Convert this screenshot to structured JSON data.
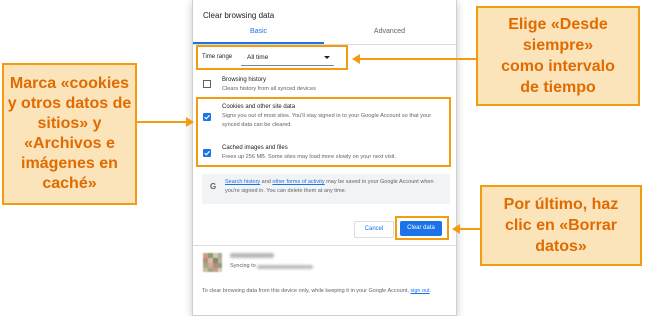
{
  "dialog": {
    "title": "Clear browsing data",
    "tabs": [
      {
        "label": "Basic",
        "selected": true
      },
      {
        "label": "Advanced",
        "selected": false
      }
    ],
    "time_range": {
      "label": "Time range",
      "value": "All time"
    },
    "options": [
      {
        "title": "Browsing history",
        "description": "Clears history from all synced devices",
        "checked": false
      },
      {
        "title": "Cookies and other site data",
        "description": "Signs you out of most sites. You'll stay signed in to your Google Account so that your synced data can be cleared.",
        "checked": true
      },
      {
        "title": "Cached images and files",
        "description": "Frees up 256 MB. Some sites may load more slowly on your next visit.",
        "checked": true
      }
    ],
    "info": {
      "icon": "google-g-icon",
      "link1": "Search history",
      "mid": " and ",
      "link2": "other forms of activity",
      "rest": " may be saved in your Google Account when you're signed in. You can delete them at any time."
    },
    "buttons": {
      "cancel": "Cancel",
      "clear": "Clear data"
    },
    "account": {
      "sync_label": "Syncing to"
    },
    "footer": {
      "text": "To clear browsing data from this device only, while keeping it in your Google Account, ",
      "link": "sign out",
      "end": "."
    }
  },
  "callouts": {
    "left": "Marca «cookies\ny otros datos de\nsitios» y\n«Archivos e\nimágenes en\ncaché»",
    "top_right": "Elige «Desde\nsiempre»\ncomo intervalo\nde tiempo",
    "bottom_right": "Por último, haz\nclic en «Borrar\ndatos»"
  },
  "colors": {
    "accent": "#1a73e8",
    "callout_border": "#f39c12",
    "callout_bg": "#fbe3ba",
    "callout_text": "#e06b00"
  }
}
